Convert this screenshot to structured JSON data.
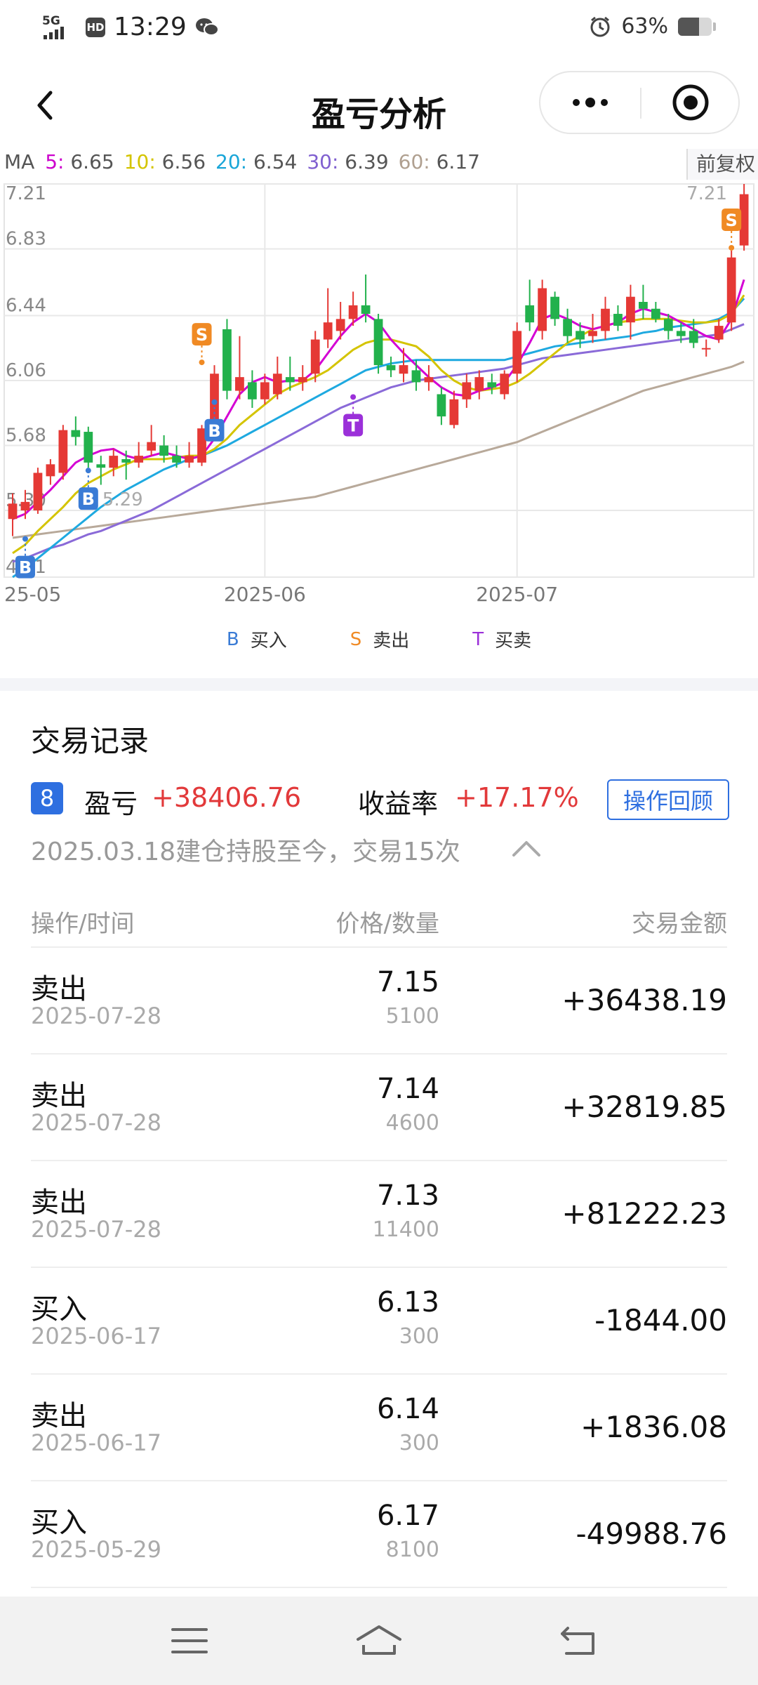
{
  "status_bar": {
    "network": "5G",
    "hd": "HD",
    "time": "13:29",
    "battery_pct": "63%",
    "battery_level": 0.63
  },
  "nav": {
    "title": "盈亏分析"
  },
  "ma": {
    "prefix": "MA",
    "items": [
      {
        "label": "5:",
        "value": "6.65",
        "color": "#cc00cc"
      },
      {
        "label": "10:",
        "value": "6.56",
        "color": "#d4c400"
      },
      {
        "label": "20:",
        "value": "6.54",
        "color": "#1aa6d8"
      },
      {
        "label": "30:",
        "value": "6.39",
        "color": "#8060d0"
      },
      {
        "label": "60:",
        "value": "6.17",
        "color": "#b0a090"
      }
    ]
  },
  "fuquan": "前复权",
  "chart_data": {
    "type": "candlestick",
    "y_ticks": [
      "7.21",
      "6.83",
      "6.44",
      "6.06",
      "5.68",
      "5.30",
      "4.91"
    ],
    "y_tick_values": [
      7.21,
      6.83,
      6.44,
      6.06,
      5.68,
      5.3,
      4.91
    ],
    "ylim": [
      4.91,
      7.21
    ],
    "right_top_label": "7.21",
    "x_ticks": [
      {
        "label": "25-05",
        "index": 0
      },
      {
        "label": "2025-06",
        "index": 20
      },
      {
        "label": "2025-07",
        "index": 40
      }
    ],
    "candles": [
      [
        5.25,
        5.34,
        5.4,
        5.15
      ],
      [
        5.3,
        5.35,
        5.42,
        5.25
      ],
      [
        5.3,
        5.52,
        5.55,
        5.28
      ],
      [
        5.5,
        5.57,
        5.6,
        5.45
      ],
      [
        5.52,
        5.77,
        5.8,
        5.48
      ],
      [
        5.77,
        5.73,
        5.85,
        5.68
      ],
      [
        5.76,
        5.58,
        5.79,
        5.55
      ],
      [
        5.57,
        5.55,
        5.62,
        5.45
      ],
      [
        5.55,
        5.62,
        5.66,
        5.5
      ],
      [
        5.6,
        5.58,
        5.65,
        5.48
      ],
      [
        5.58,
        5.62,
        5.7,
        5.55
      ],
      [
        5.65,
        5.7,
        5.8,
        5.62
      ],
      [
        5.68,
        5.62,
        5.74,
        5.58
      ],
      [
        5.62,
        5.58,
        5.68,
        5.55
      ],
      [
        5.58,
        5.62,
        5.7,
        5.55
      ],
      [
        5.58,
        5.78,
        5.8,
        5.56
      ],
      [
        5.8,
        6.1,
        6.15,
        5.78
      ],
      [
        6.36,
        6.0,
        6.42,
        5.95
      ],
      [
        6.0,
        6.08,
        6.32,
        5.95
      ],
      [
        6.05,
        5.95,
        6.12,
        5.9
      ],
      [
        5.95,
        6.05,
        6.1,
        5.92
      ],
      [
        5.98,
        6.1,
        6.2,
        5.95
      ],
      [
        6.08,
        6.05,
        6.2,
        6.0
      ],
      [
        6.05,
        6.08,
        6.15,
        6.0
      ],
      [
        6.1,
        6.3,
        6.35,
        6.05
      ],
      [
        6.3,
        6.4,
        6.6,
        6.25
      ],
      [
        6.35,
        6.42,
        6.52,
        6.3
      ],
      [
        6.42,
        6.5,
        6.58,
        6.38
      ],
      [
        6.5,
        6.45,
        6.68,
        6.4
      ],
      [
        6.42,
        6.15,
        6.45,
        6.1
      ],
      [
        6.15,
        6.12,
        6.2,
        6.08
      ],
      [
        6.1,
        6.15,
        6.25,
        6.05
      ],
      [
        6.12,
        6.05,
        6.18,
        6.0
      ],
      [
        6.05,
        6.08,
        6.15,
        6.0
      ],
      [
        5.98,
        5.85,
        6.02,
        5.8
      ],
      [
        5.8,
        5.95,
        6.0,
        5.78
      ],
      [
        5.95,
        6.05,
        6.1,
        5.9
      ],
      [
        6.0,
        6.08,
        6.12,
        5.95
      ],
      [
        6.05,
        6.02,
        6.1,
        5.98
      ],
      [
        5.98,
        6.1,
        6.12,
        5.95
      ],
      [
        6.1,
        6.35,
        6.4,
        6.05
      ],
      [
        6.5,
        6.4,
        6.65,
        6.35
      ],
      [
        6.35,
        6.6,
        6.65,
        6.3
      ],
      [
        6.55,
        6.42,
        6.58,
        6.38
      ],
      [
        6.42,
        6.32,
        6.48,
        6.28
      ],
      [
        6.35,
        6.3,
        6.4,
        6.25
      ],
      [
        6.32,
        6.35,
        6.45,
        6.28
      ],
      [
        6.35,
        6.48,
        6.55,
        6.3
      ],
      [
        6.45,
        6.38,
        6.5,
        6.35
      ],
      [
        6.4,
        6.55,
        6.62,
        6.3
      ],
      [
        6.52,
        6.48,
        6.62,
        6.42
      ],
      [
        6.48,
        6.42,
        6.52,
        6.4
      ],
      [
        6.42,
        6.35,
        6.45,
        6.3
      ],
      [
        6.35,
        6.32,
        6.4,
        6.28
      ],
      [
        6.35,
        6.28,
        6.42,
        6.25
      ],
      [
        6.25,
        6.25,
        6.3,
        6.2
      ],
      [
        6.3,
        6.38,
        6.42,
        6.28
      ],
      [
        6.4,
        6.78,
        6.82,
        6.35
      ],
      [
        6.85,
        7.15,
        7.21,
        6.82
      ]
    ],
    "ma_series": {
      "ma5": [
        5.25,
        5.28,
        5.35,
        5.42,
        5.5,
        5.58,
        5.62,
        5.65,
        5.66,
        5.62,
        5.6,
        5.62,
        5.64,
        5.62,
        5.6,
        5.62,
        5.72,
        5.85,
        5.98,
        6.05,
        6.08,
        6.05,
        6.06,
        6.06,
        6.12,
        6.22,
        6.32,
        6.4,
        6.45,
        6.4,
        6.3,
        6.22,
        6.15,
        6.08,
        6.02,
        5.98,
        5.97,
        6.0,
        6.02,
        6.05,
        6.15,
        6.28,
        6.42,
        6.45,
        6.42,
        6.38,
        6.36,
        6.38,
        6.4,
        6.45,
        6.48,
        6.46,
        6.44,
        6.4,
        6.36,
        6.32,
        6.3,
        6.42,
        6.65
      ],
      "ma10": [
        5.05,
        5.1,
        5.18,
        5.25,
        5.32,
        5.4,
        5.46,
        5.5,
        5.54,
        5.57,
        5.6,
        5.6,
        5.6,
        5.61,
        5.62,
        5.62,
        5.66,
        5.72,
        5.8,
        5.86,
        5.92,
        5.98,
        6.02,
        6.05,
        6.08,
        6.12,
        6.18,
        6.24,
        6.28,
        6.3,
        6.3,
        6.28,
        6.26,
        6.2,
        6.12,
        6.06,
        6.02,
        6.0,
        6.01,
        6.02,
        6.05,
        6.1,
        6.16,
        6.22,
        6.28,
        6.32,
        6.36,
        6.38,
        6.4,
        6.41,
        6.42,
        6.42,
        6.42,
        6.41,
        6.4,
        6.4,
        6.41,
        6.45,
        6.56
      ],
      "ma20": [
        4.91,
        4.96,
        5.02,
        5.08,
        5.14,
        5.2,
        5.26,
        5.32,
        5.37,
        5.42,
        5.46,
        5.5,
        5.54,
        5.57,
        5.6,
        5.62,
        5.65,
        5.68,
        5.72,
        5.76,
        5.8,
        5.84,
        5.88,
        5.92,
        5.96,
        6.0,
        6.04,
        6.08,
        6.12,
        6.14,
        6.16,
        6.17,
        6.18,
        6.18,
        6.18,
        6.18,
        6.18,
        6.18,
        6.18,
        6.18,
        6.2,
        6.22,
        6.24,
        6.26,
        6.27,
        6.28,
        6.29,
        6.3,
        6.31,
        6.32,
        6.34,
        6.35,
        6.37,
        6.38,
        6.39,
        6.4,
        6.42,
        6.46,
        6.54
      ],
      "ma30": [
        5.0,
        5.02,
        5.05,
        5.08,
        5.1,
        5.13,
        5.16,
        5.18,
        5.21,
        5.24,
        5.27,
        5.3,
        5.34,
        5.38,
        5.42,
        5.46,
        5.5,
        5.54,
        5.58,
        5.62,
        5.66,
        5.7,
        5.74,
        5.78,
        5.82,
        5.86,
        5.9,
        5.93,
        5.96,
        5.99,
        6.02,
        6.04,
        6.06,
        6.07,
        6.08,
        6.09,
        6.1,
        6.11,
        6.12,
        6.13,
        6.15,
        6.17,
        6.19,
        6.2,
        6.21,
        6.22,
        6.23,
        6.24,
        6.25,
        6.26,
        6.27,
        6.28,
        6.29,
        6.3,
        6.31,
        6.32,
        6.33,
        6.36,
        6.39
      ],
      "ma60": [
        5.14,
        5.15,
        5.16,
        5.17,
        5.18,
        5.19,
        5.2,
        5.21,
        5.22,
        5.23,
        5.24,
        5.25,
        5.26,
        5.27,
        5.28,
        5.29,
        5.3,
        5.31,
        5.32,
        5.33,
        5.34,
        5.35,
        5.36,
        5.37,
        5.38,
        5.4,
        5.42,
        5.44,
        5.46,
        5.48,
        5.5,
        5.52,
        5.54,
        5.56,
        5.58,
        5.6,
        5.62,
        5.64,
        5.66,
        5.68,
        5.7,
        5.73,
        5.76,
        5.79,
        5.82,
        5.85,
        5.88,
        5.91,
        5.94,
        5.97,
        6.0,
        6.02,
        6.04,
        6.06,
        6.08,
        6.1,
        6.12,
        6.14,
        6.17
      ]
    },
    "markers": [
      {
        "type": "B",
        "index": 1,
        "price": 5.15,
        "below": true
      },
      {
        "type": "B",
        "index": 6,
        "price": 5.55,
        "below": true,
        "label": "5.29"
      },
      {
        "type": "S",
        "index": 15,
        "price": 6.15,
        "below": false
      },
      {
        "type": "B",
        "index": 16,
        "price": 5.95,
        "below": true
      },
      {
        "type": "T",
        "index": 27,
        "price": 5.98,
        "below": true
      },
      {
        "type": "S",
        "index": 57,
        "price": 6.82,
        "below": false
      }
    ]
  },
  "legend": [
    {
      "letter": "B",
      "label": "买入",
      "color": "#3a7bd5"
    },
    {
      "letter": "S",
      "label": "卖出",
      "color": "#f08a24"
    },
    {
      "letter": "T",
      "label": "买卖",
      "color": "#9b30d9"
    }
  ],
  "records": {
    "title": "交易记录",
    "count": "8",
    "pl_label": "盈亏",
    "pl_value": "+38406.76",
    "rate_label": "收益率",
    "rate_value": "+17.17%",
    "review_button": "操作回顾",
    "since": "2025.03.18建仓持股至今，交易15次",
    "columns": [
      "操作/时间",
      "价格/数量",
      "交易金额"
    ],
    "rows": [
      {
        "action": "卖出",
        "date": "2025-07-28",
        "price": "7.15",
        "qty": "5100",
        "amount": "+36438.19"
      },
      {
        "action": "卖出",
        "date": "2025-07-28",
        "price": "7.14",
        "qty": "4600",
        "amount": "+32819.85"
      },
      {
        "action": "卖出",
        "date": "2025-07-28",
        "price": "7.13",
        "qty": "11400",
        "amount": "+81222.23"
      },
      {
        "action": "买入",
        "date": "2025-06-17",
        "price": "6.13",
        "qty": "300",
        "amount": "-1844.00"
      },
      {
        "action": "卖出",
        "date": "2025-06-17",
        "price": "6.14",
        "qty": "300",
        "amount": "+1836.08"
      },
      {
        "action": "买入",
        "date": "2025-05-29",
        "price": "6.17",
        "qty": "8100",
        "amount": "-49988.76"
      }
    ]
  },
  "colors": {
    "up": "#e53935",
    "down": "#22b14c",
    "accent": "#2e6fe0"
  }
}
